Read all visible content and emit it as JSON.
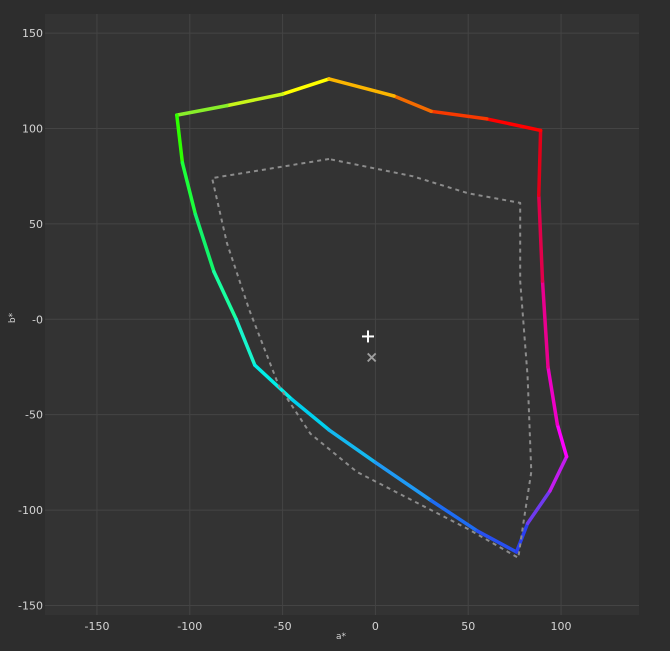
{
  "chart_data": {
    "type": "line",
    "title": "",
    "xlabel": "a*",
    "ylabel": "b*",
    "xlim": [
      -178,
      142
    ],
    "ylim": [
      -155,
      160
    ],
    "xticks": [
      -150,
      -100,
      -50,
      0,
      50,
      100
    ],
    "yticks": [
      150,
      100,
      50,
      0,
      -50,
      -100,
      -150
    ],
    "xtick_labels": [
      "-150",
      "-100",
      "-50",
      "0",
      "50",
      "100"
    ],
    "ytick_labels": [
      "150",
      "100",
      "50",
      "-0",
      "-50",
      "-100",
      "-150"
    ],
    "grid": true,
    "series": [
      {
        "style": "solid-gradient",
        "closed": true,
        "x": [
          -25,
          -50,
          -80,
          -107,
          -104,
          -97,
          -87,
          -75,
          -65,
          -45,
          -25,
          0,
          30,
          55,
          76,
          82,
          94,
          103,
          98,
          93,
          90,
          88,
          89,
          60,
          30,
          10
        ],
        "y": [
          126,
          118,
          112,
          107,
          82,
          55,
          25,
          0,
          -24,
          -42,
          -58,
          -75,
          -95,
          -111,
          -122,
          -107,
          -90,
          -72,
          -55,
          -25,
          20,
          65,
          99,
          105,
          109,
          117
        ],
        "colors": [
          "#ffff00",
          "#c8f51a",
          "#88ee2a",
          "#2eff00",
          "#1cff3a",
          "#12f56a",
          "#18ffa0",
          "#18f5cc",
          "#00efe8",
          "#00d0ee",
          "#14b8f0",
          "#1f9af5",
          "#1e6cf2",
          "#2850f0",
          "#2a3ff0",
          "#6f3aee",
          "#c21cee",
          "#ff00ff",
          "#ee00c5",
          "#e8008e",
          "#e0004a",
          "#e20018",
          "#ff0000",
          "#f73900",
          "#f36b00",
          "#fbb500"
        ]
      },
      {
        "style": "dashed",
        "closed": true,
        "color": "#8c8c8c",
        "x": [
          -25,
          -50,
          -88,
          -80,
          -68,
          -52,
          -35,
          -10,
          20,
          50,
          77,
          80,
          84,
          82,
          78,
          78,
          50,
          20
        ],
        "y": [
          84,
          80,
          74,
          40,
          5,
          -35,
          -60,
          -80,
          -95,
          -110,
          -125,
          -105,
          -80,
          -30,
          20,
          61,
          66,
          75
        ]
      }
    ],
    "markers": [
      {
        "name": "white-point-target",
        "symbol": "+",
        "x": -4,
        "y": -9,
        "color": "#ffffff"
      },
      {
        "name": "white-point-measured",
        "symbol": "x",
        "x": -2,
        "y": -20,
        "color": "#9e9e9e"
      }
    ]
  }
}
